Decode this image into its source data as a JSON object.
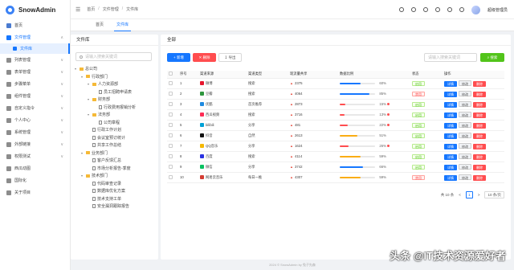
{
  "app": {
    "name": "SnowAdmin"
  },
  "sidebar": {
    "items": [
      {
        "label": "首页",
        "arrow": ""
      },
      {
        "label": "文件管理",
        "arrow": "∧"
      },
      {
        "label": "列表管理",
        "arrow": "∨"
      },
      {
        "label": "表单管理",
        "arrow": "∨"
      },
      {
        "label": "步骤菜单",
        "arrow": "∨"
      },
      {
        "label": "组件管理",
        "arrow": "∨"
      },
      {
        "label": "自定义指令",
        "arrow": "∨"
      },
      {
        "label": "个人中心",
        "arrow": "∨"
      },
      {
        "label": "系统管理",
        "arrow": "∨"
      },
      {
        "label": "外部链接",
        "arrow": "∨"
      },
      {
        "label": "权限测试",
        "arrow": "∨"
      },
      {
        "label": "西瓜动图",
        "arrow": ""
      },
      {
        "label": "国际化",
        "arrow": ""
      },
      {
        "label": "关于项目",
        "arrow": ""
      }
    ],
    "active_sub": "文件库"
  },
  "header": {
    "breadcrumb": [
      "首页",
      "文件管理",
      "文件库"
    ],
    "username": "超级管理员"
  },
  "tabs": [
    "首页",
    "文件库"
  ],
  "tree": {
    "title": "文件库",
    "search_placeholder": "请输入搜索关键词",
    "nodes": [
      {
        "label": "总公司",
        "level": 0,
        "type": "folder",
        "caret": "▾"
      },
      {
        "label": "行政部门",
        "level": 1,
        "type": "folder",
        "caret": "▾"
      },
      {
        "label": "人力资源部",
        "level": 2,
        "type": "folder",
        "caret": "▾"
      },
      {
        "label": "员工招聘申请表",
        "level": 3,
        "type": "file",
        "caret": ""
      },
      {
        "label": "财务部",
        "level": 2,
        "type": "folder",
        "caret": "▾"
      },
      {
        "label": "行政费用报销分析",
        "level": 3,
        "type": "file",
        "caret": ""
      },
      {
        "label": "法务部",
        "level": 2,
        "type": "folder",
        "caret": "▾"
      },
      {
        "label": "公司章程",
        "level": 3,
        "type": "file",
        "caret": ""
      },
      {
        "label": "行政工作计划",
        "level": 2,
        "type": "file",
        "caret": ""
      },
      {
        "label": "会议室预订统计",
        "level": 2,
        "type": "file",
        "caret": ""
      },
      {
        "label": "共享工作总结",
        "level": 2,
        "type": "file",
        "caret": ""
      },
      {
        "label": "业务部门",
        "level": 1,
        "type": "folder",
        "caret": "▾"
      },
      {
        "label": "客户反馈汇总",
        "level": 2,
        "type": "file",
        "caret": ""
      },
      {
        "label": "市场分析报告-季度",
        "level": 2,
        "type": "file",
        "caret": ""
      },
      {
        "label": "技术部门",
        "level": 1,
        "type": "folder",
        "caret": "▾"
      },
      {
        "label": "代码审查记录",
        "level": 2,
        "type": "file",
        "caret": ""
      },
      {
        "label": "数据库优化方案",
        "level": 2,
        "type": "file",
        "caret": ""
      },
      {
        "label": "技术支持工单",
        "level": 2,
        "type": "file",
        "caret": ""
      },
      {
        "label": "安全漏洞跟踪报告",
        "level": 2,
        "type": "file",
        "caret": ""
      }
    ]
  },
  "main": {
    "title": "全部",
    "add_label": "新增",
    "delete_label": "删除",
    "export_label": "导出",
    "search_placeholder": "请输入搜索关键词",
    "search_label": "搜索",
    "columns": [
      "",
      "序号",
      "渠道来源",
      "渠道类型",
      "现流量共享",
      "数据比例",
      "状态",
      "操作"
    ],
    "rows": [
      {
        "no": "1",
        "source": "微博",
        "color": "#e6162d",
        "type": "搜索",
        "trend": "up",
        "traffic": "2375",
        "ratio": 60,
        "warn": false,
        "status": "启用",
        "on": true
      },
      {
        "no": "2",
        "source": "豆瓣",
        "color": "#2e963d",
        "type": "搜索",
        "trend": "up",
        "traffic": "4064",
        "ratio": 85,
        "warn": false,
        "status": "禁用",
        "on": false
      },
      {
        "no": "3",
        "source": "优酷",
        "color": "#1f8ae0",
        "type": "首页推荐",
        "trend": "up",
        "traffic": "2873",
        "ratio": 15,
        "warn": true,
        "status": "启用",
        "on": true
      },
      {
        "no": "4",
        "source": "西瓜视频",
        "color": "#fe2c55",
        "type": "搜索",
        "trend": "up",
        "traffic": "3716",
        "ratio": 13,
        "warn": true,
        "status": "启用",
        "on": true
      },
      {
        "no": "5",
        "source": "bilibili",
        "color": "#00a1d6",
        "type": "分享",
        "trend": "up",
        "traffic": "481",
        "ratio": 22,
        "warn": true,
        "status": "启用",
        "on": true
      },
      {
        "no": "6",
        "source": "抖音",
        "color": "#111111",
        "type": "自然",
        "trend": "up",
        "traffic": "2613",
        "ratio": 51,
        "warn": false,
        "status": "启用",
        "on": true
      },
      {
        "no": "7",
        "source": "QQ音乐",
        "color": "#f5b800",
        "type": "分享",
        "trend": "up",
        "traffic": "1624",
        "ratio": 26,
        "warn": true,
        "status": "启用",
        "on": true
      },
      {
        "no": "8",
        "source": "百度",
        "color": "#2932e1",
        "type": "搜索",
        "trend": "up",
        "traffic": "4114",
        "ratio": 59,
        "warn": false,
        "status": "启用",
        "on": true
      },
      {
        "no": "9",
        "source": "微信",
        "color": "#07c160",
        "type": "分享",
        "trend": "up",
        "traffic": "3742",
        "ratio": 66,
        "warn": false,
        "status": "启用",
        "on": true
      },
      {
        "no": "10",
        "source": "网易云音乐",
        "color": "#d43c33",
        "type": "每日一推",
        "trend": "up",
        "traffic": "4307",
        "ratio": 59,
        "warn": false,
        "status": "禁用",
        "on": false
      }
    ],
    "op_detail": "详情",
    "op_edit": "修改",
    "op_delete": "删除",
    "pager": {
      "total": "共 10 条",
      "prev": "<",
      "page": "1",
      "next": ">",
      "size": "10 条/页"
    }
  },
  "footer": "2024 © SnowAdmin by 兔子先森",
  "watermark": "头条 @IT技术资源爱好者"
}
